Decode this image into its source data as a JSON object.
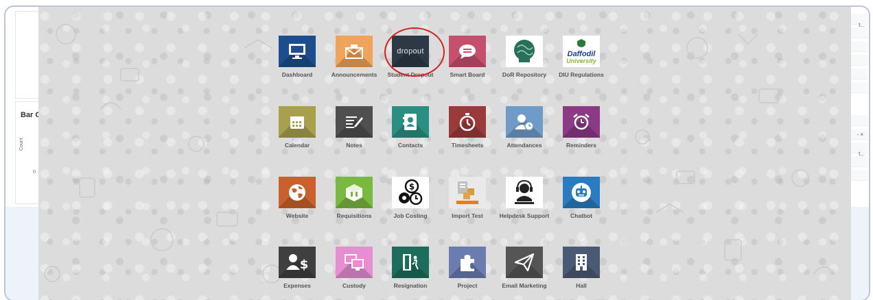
{
  "background": {
    "chart_title": "Bar C",
    "axis_label": "Count",
    "zero_tick": "0",
    "right_text_1": "t...",
    "right_text_2": "t...",
    "right_close": "- ×"
  },
  "apps": [
    {
      "label": "Dashboard",
      "color": "#1d4d8c",
      "icon": "monitor-icon"
    },
    {
      "label": "Announcements",
      "color": "#f0a35a",
      "icon": "envelope-icon"
    },
    {
      "label": "Student Dropout",
      "color": "#2d3a46",
      "icon": "dropout-logo",
      "tile_text": "dropout"
    },
    {
      "label": "Smart Board",
      "color": "#c4506d",
      "icon": "speech-bubble-icon"
    },
    {
      "label": "DoR Repository",
      "color": "#ffffff",
      "icon": "brain-logo"
    },
    {
      "label": "DIU Regulations",
      "color": "#ffffff",
      "icon": "daffodil-logo",
      "tile_text_1": "Daffodil",
      "tile_text_2": "University"
    },
    {
      "label": "Calendar",
      "color": "#a9a04e",
      "icon": "calendar-icon"
    },
    {
      "label": "Notes",
      "color": "#4f4f4f",
      "icon": "notes-icon"
    },
    {
      "label": "Contacts",
      "color": "#2a8f83",
      "icon": "contacts-icon"
    },
    {
      "label": "Timesheets",
      "color": "#9b3a3a",
      "icon": "stopwatch-icon"
    },
    {
      "label": "Attendances",
      "color": "#6e9bc7",
      "icon": "person-clock-icon"
    },
    {
      "label": "Reminders",
      "color": "#8b3a86",
      "icon": "alarm-clock-icon"
    },
    {
      "label": "Website",
      "color": "#c8612d",
      "icon": "globe-icon"
    },
    {
      "label": "Requisitions",
      "color": "#7ab940",
      "icon": "box-icon"
    },
    {
      "label": "Job Costing",
      "color": "#ffffff",
      "icon": "dollar-gears-icon"
    },
    {
      "label": "Import Test",
      "color": "#e9e9e9",
      "icon": "import-icon"
    },
    {
      "label": "Helpdesk Support",
      "color": "#ffffff",
      "icon": "headset-icon"
    },
    {
      "label": "Chatbot",
      "color": "#2a7bbf",
      "icon": "robot-icon"
    },
    {
      "label": "Expenses",
      "color": "#3f3f3f",
      "icon": "person-dollar-icon"
    },
    {
      "label": "Custody",
      "color": "#e58fd2",
      "icon": "screens-icon"
    },
    {
      "label": "Resignation",
      "color": "#1c6d5c",
      "icon": "exit-door-icon"
    },
    {
      "label": "Project",
      "color": "#6a7cb0",
      "icon": "puzzle-icon"
    },
    {
      "label": "Email Marketing",
      "color": "#555555",
      "icon": "paper-plane-icon"
    },
    {
      "label": "Hall",
      "color": "#4a5a75",
      "icon": "building-icon"
    }
  ]
}
